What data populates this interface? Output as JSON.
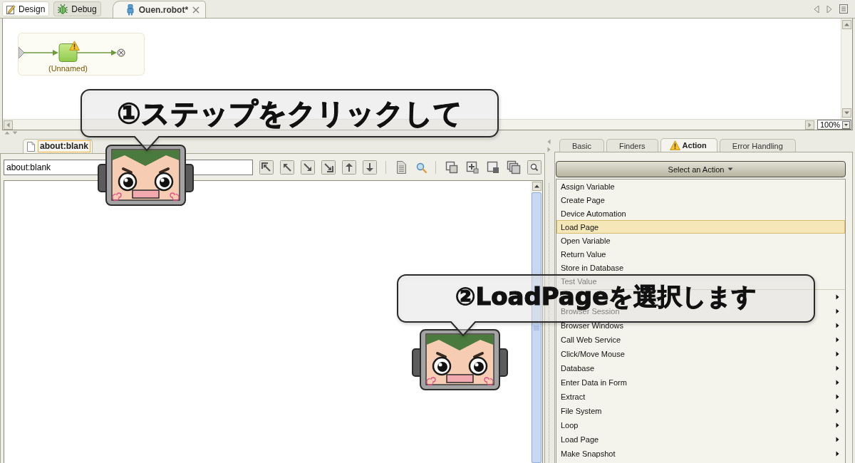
{
  "perspective_tabs": [
    {
      "kind": "design",
      "label": "Design",
      "selected": true
    },
    {
      "kind": "debug",
      "label": "Debug",
      "selected": false
    }
  ],
  "editor_tab": {
    "label": "Ouen.robot*"
  },
  "diagram": {
    "steps": [
      {
        "label": "(Unnamed)",
        "warning": true
      }
    ],
    "zoom": "100%"
  },
  "browser": {
    "tab": "about:blank",
    "address": "about:blank"
  },
  "step_tabs": [
    {
      "label": "Basic",
      "selected": false,
      "warning": false
    },
    {
      "label": "Finders",
      "selected": false,
      "warning": false
    },
    {
      "label": "Action",
      "selected": true,
      "warning": true
    },
    {
      "label": "Error Handling",
      "selected": false,
      "warning": false
    }
  ],
  "action_selector": {
    "label": "Select an Action"
  },
  "actions": [
    {
      "label": "Assign Variable",
      "selected": false
    },
    {
      "label": "Create Page",
      "selected": false
    },
    {
      "label": "Device Automation",
      "selected": false
    },
    {
      "label": "Load Page",
      "selected": true
    },
    {
      "label": "Open Variable",
      "selected": false
    },
    {
      "label": "Return Value",
      "selected": false
    },
    {
      "label": "Store in Database",
      "selected": false
    },
    {
      "label": "Test Value",
      "selected": false
    }
  ],
  "action_categories": [
    {
      "selected": false
    },
    {
      "label": "Browser Session",
      "selected": false
    },
    {
      "label": "Browser Windows",
      "selected": false
    },
    {
      "label": "Call Web Service",
      "selected": false
    },
    {
      "label": "Click/Move Mouse",
      "selected": false
    },
    {
      "label": "Database",
      "selected": false
    },
    {
      "label": "Enter Data in Form",
      "selected": false
    },
    {
      "label": "Extract",
      "selected": false
    },
    {
      "label": "File System",
      "selected": false
    },
    {
      "label": "Loop",
      "selected": false
    },
    {
      "label": "Load Page",
      "selected": false
    },
    {
      "label": "Make Snapshot",
      "selected": false
    }
  ],
  "callouts": [
    {
      "text": "①ステップをクリックして"
    },
    {
      "text": "②LoadPageを選択します"
    }
  ]
}
